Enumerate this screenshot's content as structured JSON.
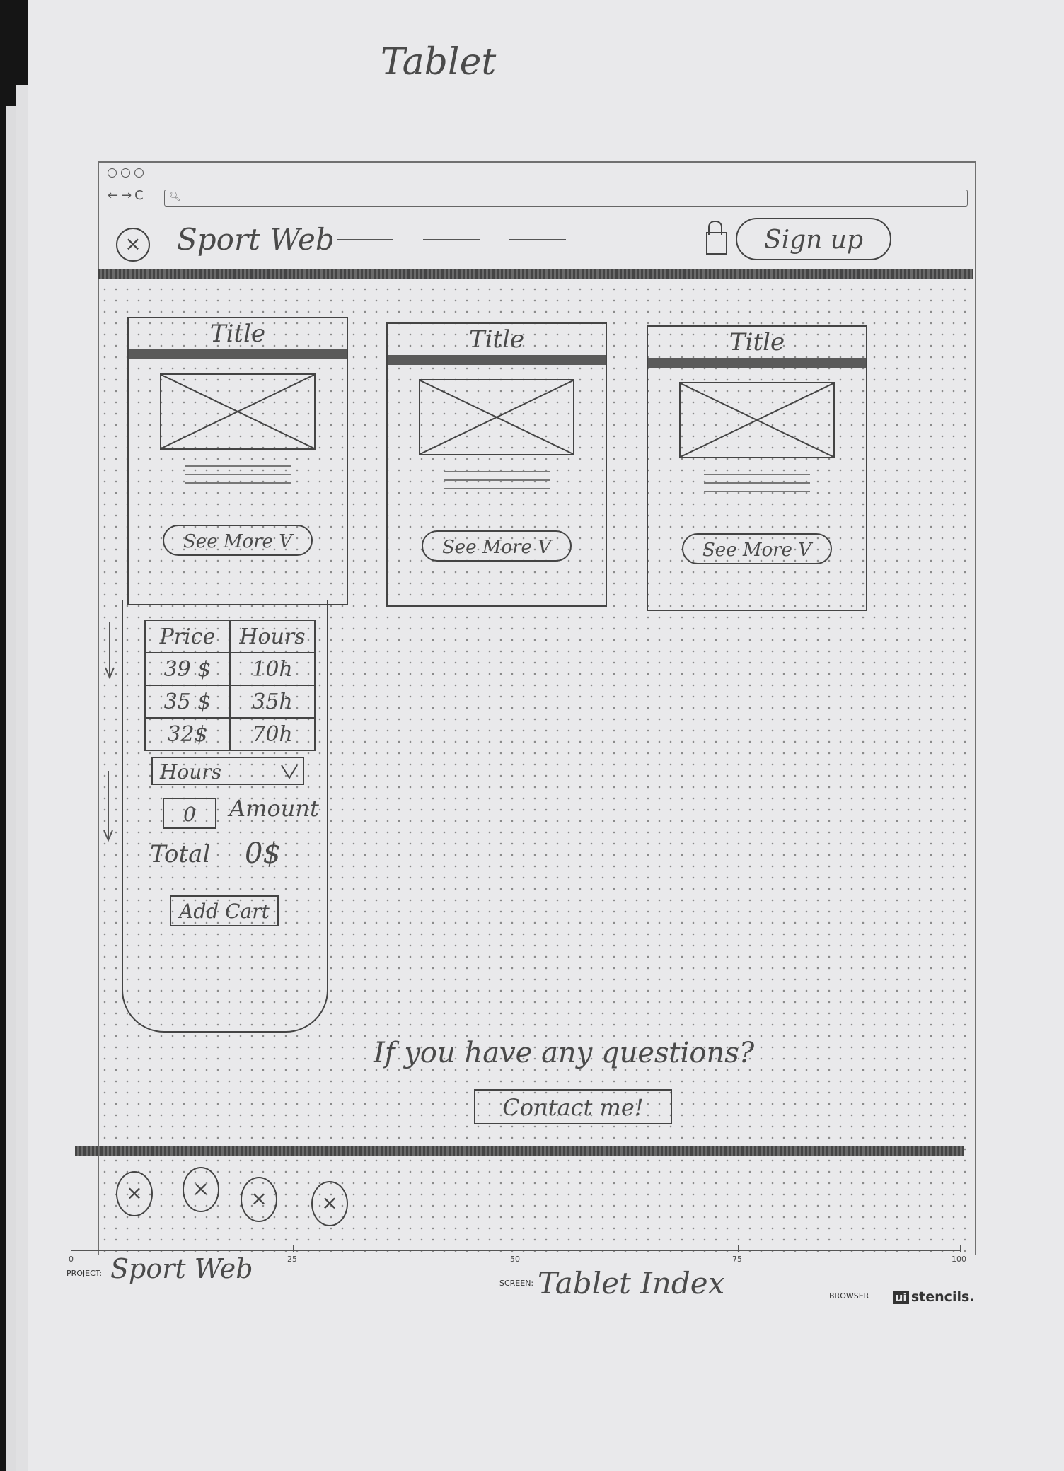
{
  "page_label": "Tablet",
  "browser": {
    "nav_glyphs": "←→C",
    "search_icon": "search-icon"
  },
  "header": {
    "logo_glyph": "×",
    "brand": "Sport Web",
    "signup_label": "Sign up"
  },
  "cards": [
    {
      "title": "Title",
      "button": "See More V"
    },
    {
      "title": "Title",
      "button": "See More V"
    },
    {
      "title": "Title",
      "button": "See More V"
    }
  ],
  "pricing": {
    "headers": [
      "Price",
      "Hours"
    ],
    "rows": [
      [
        "39 $",
        "10h"
      ],
      [
        "35 $",
        "35h"
      ],
      [
        "32$",
        "70h"
      ]
    ],
    "select_value": "Hours",
    "amount_value": "0",
    "amount_label": "Amount",
    "total_label": "Total",
    "total_value": "0$",
    "add_cart_label": "Add Cart"
  },
  "contact": {
    "question": "If you have any questions?",
    "button": "Contact me!"
  },
  "footer_icons": [
    "×",
    "×",
    "×",
    "×"
  ],
  "sheet_footer": {
    "project_label": "PROJECT:",
    "project_value": "Sport Web",
    "screen_label": "SCREEN:",
    "screen_value": "Tablet Index",
    "browser_label": "BROWSER",
    "brand_box": "ui",
    "brand_text": "stencils.",
    "ruler_ticks": [
      "0",
      "25",
      "50",
      "75",
      "100"
    ]
  }
}
